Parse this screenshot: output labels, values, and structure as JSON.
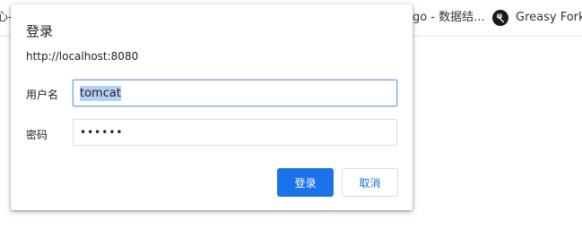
{
  "bookmarks": {
    "left_fragment": "心-",
    "middle_item": "go - 数据结...",
    "greasy_fork": "Greasy Fork -"
  },
  "dialog": {
    "title": "登录",
    "origin": "http://localhost:8080",
    "username_label": "用户名",
    "username_value": "tomcat",
    "password_label": "密码",
    "password_value": "••••••",
    "login_button": "登录",
    "cancel_button": "取消"
  },
  "colors": {
    "accent": "#1a73e8",
    "selection": "#b4d0f3",
    "focus_border": "#7aa7e0"
  }
}
